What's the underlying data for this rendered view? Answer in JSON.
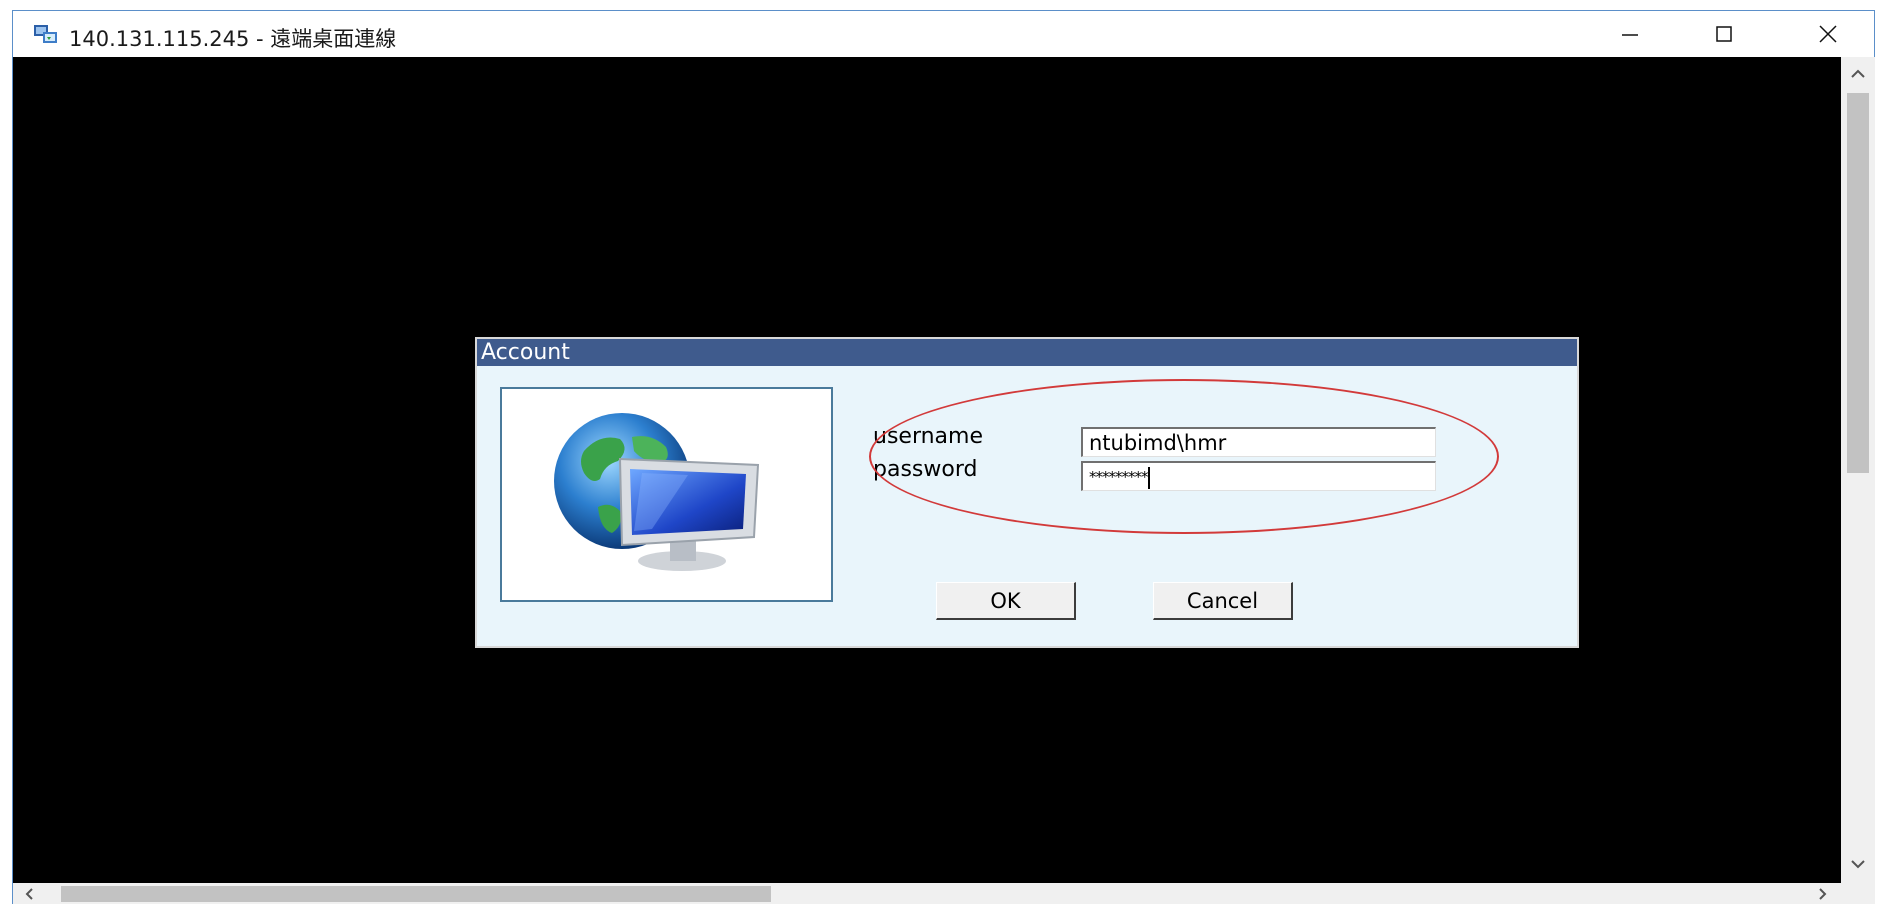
{
  "window": {
    "title": "140.131.115.245 - 遠端桌面連線",
    "app_icon": "remote-desktop-icon",
    "controls": {
      "minimize_icon": "minimize-icon",
      "maximize_icon": "maximize-icon",
      "close_icon": "close-icon"
    }
  },
  "dialog": {
    "title": "Account",
    "image": "globe-monitor-icon",
    "username_label": "username",
    "username_value": "ntubimd\\hmr",
    "password_label": "password",
    "password_value": "*********",
    "ok_label": "OK",
    "cancel_label": "Cancel",
    "highlight_color": "#d23a3a"
  },
  "colors": {
    "dialog_title_bg": "#3f5b8d",
    "dialog_bg": "#e9f5fb",
    "viewport_bg": "#000000"
  }
}
